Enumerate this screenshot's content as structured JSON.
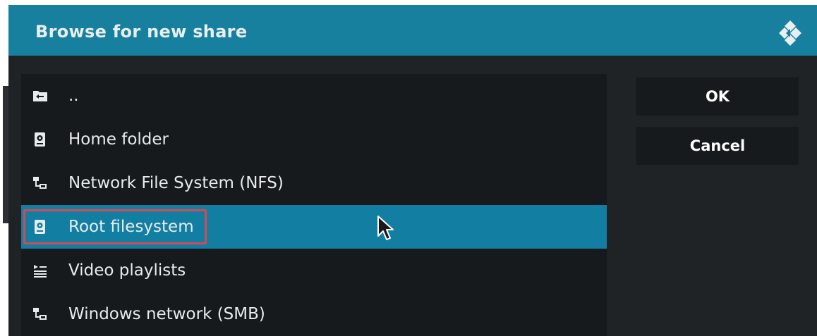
{
  "dialog": {
    "title": "Browse for new share",
    "logo_icon": "kodi-logo-icon",
    "accent_color": "#17809f",
    "selected_color": "#127fa2",
    "highlight_color": "#d24a53"
  },
  "list": {
    "items": [
      {
        "label": "..",
        "icon": "folder-back-icon",
        "selected": false
      },
      {
        "label": "Home folder",
        "icon": "drive-icon",
        "selected": false
      },
      {
        "label": "Network File System (NFS)",
        "icon": "network-icon",
        "selected": false
      },
      {
        "label": "Root filesystem",
        "icon": "drive-icon",
        "selected": true
      },
      {
        "label": "Video playlists",
        "icon": "playlist-icon",
        "selected": false
      },
      {
        "label": "Windows network (SMB)",
        "icon": "network-icon",
        "selected": false
      }
    ]
  },
  "buttons": {
    "ok_label": "OK",
    "cancel_label": "Cancel"
  }
}
